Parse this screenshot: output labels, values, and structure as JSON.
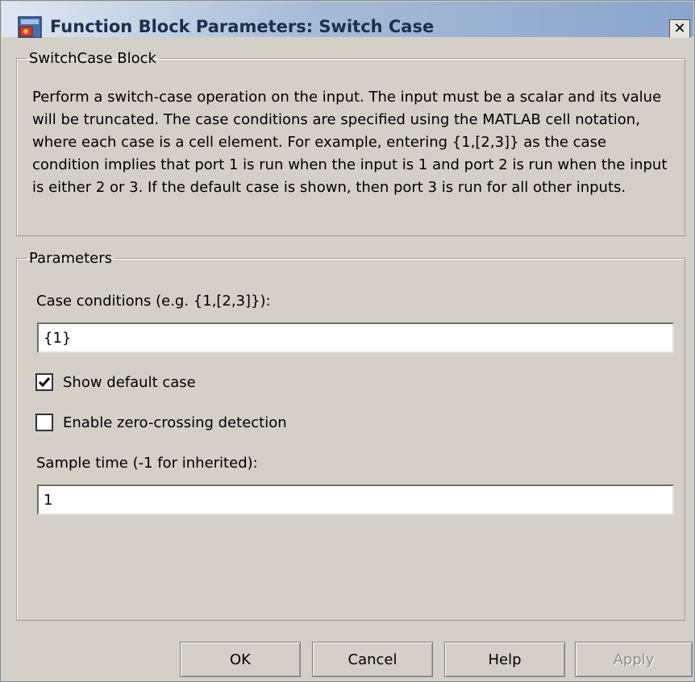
{
  "window": {
    "title": "Function Block Parameters: Switch Case",
    "close_label": "✕"
  },
  "block_group": {
    "legend": "SwitchCase Block",
    "description": "Perform a switch-case operation on the input.  The input must be a scalar and its value will be truncated.  The case conditions are specified using the MATLAB cell notation, where each case is a cell element.  For example, entering {1,[2,3]} as the case condition implies that port 1 is run when the input is 1 and port 2 is run when the input is either 2 or 3.  If the default case is shown, then port 3 is run for all other inputs."
  },
  "parameters": {
    "legend": "Parameters",
    "case_conditions_label": "Case conditions (e.g. {1,[2,3]}):",
    "case_conditions_value": "{1}",
    "show_default_label": "Show default case",
    "show_default_checked": true,
    "zero_crossing_label": "Enable zero-crossing detection",
    "zero_crossing_checked": false,
    "sample_time_label": "Sample time (-1 for inherited):",
    "sample_time_value": "1"
  },
  "buttons": {
    "ok": "OK",
    "cancel": "Cancel",
    "help": "Help",
    "apply": "Apply"
  },
  "colors": {
    "dialog_bg": "#d4d0c8",
    "title_text": "#1b2f4e",
    "disabled_text": "#8c8c8c"
  }
}
